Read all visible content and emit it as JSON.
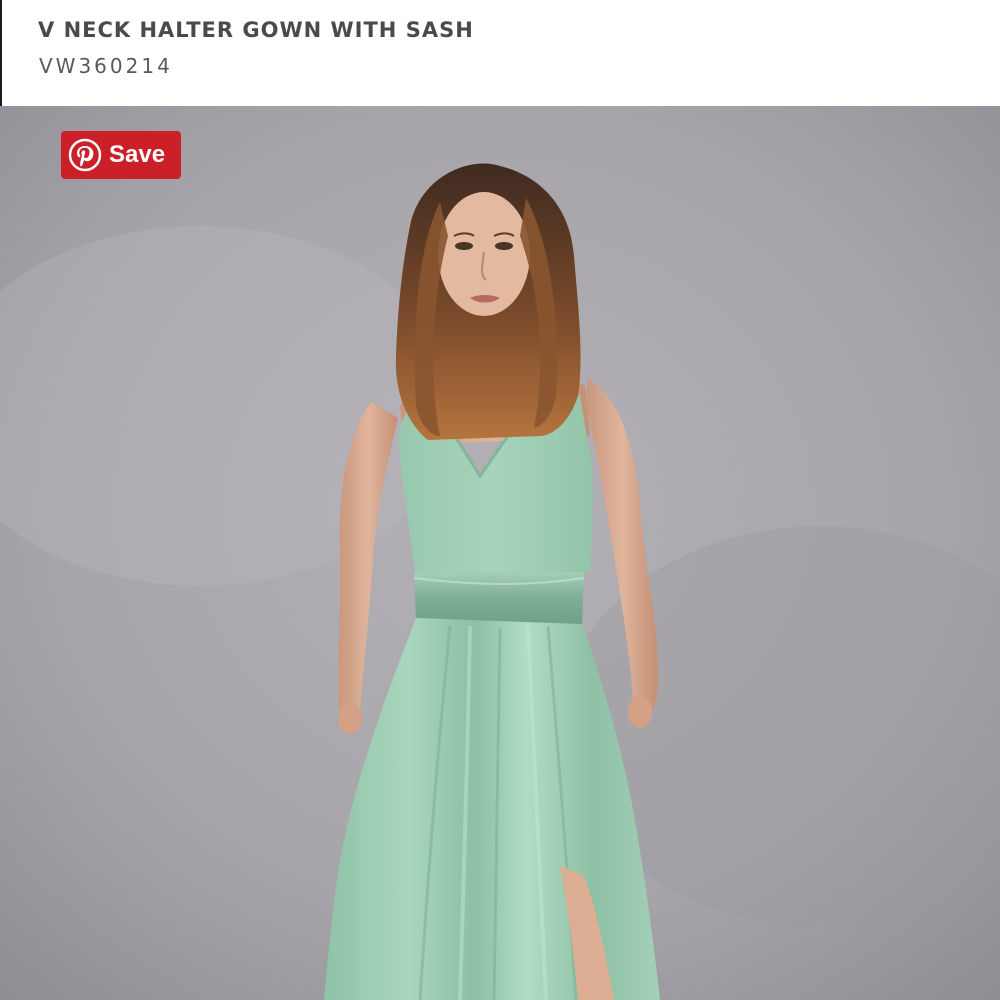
{
  "product": {
    "title": "V NECK HALTER GOWN WITH SASH",
    "sku": "VW360214"
  },
  "pin_button": {
    "label": "Save",
    "icon": "pinterest-icon",
    "color": "#cb2027"
  },
  "photo": {
    "subject": "model-wearing-gown",
    "backdrop_color": "#a9a7ac",
    "dress_color": "#9ccbb2"
  }
}
